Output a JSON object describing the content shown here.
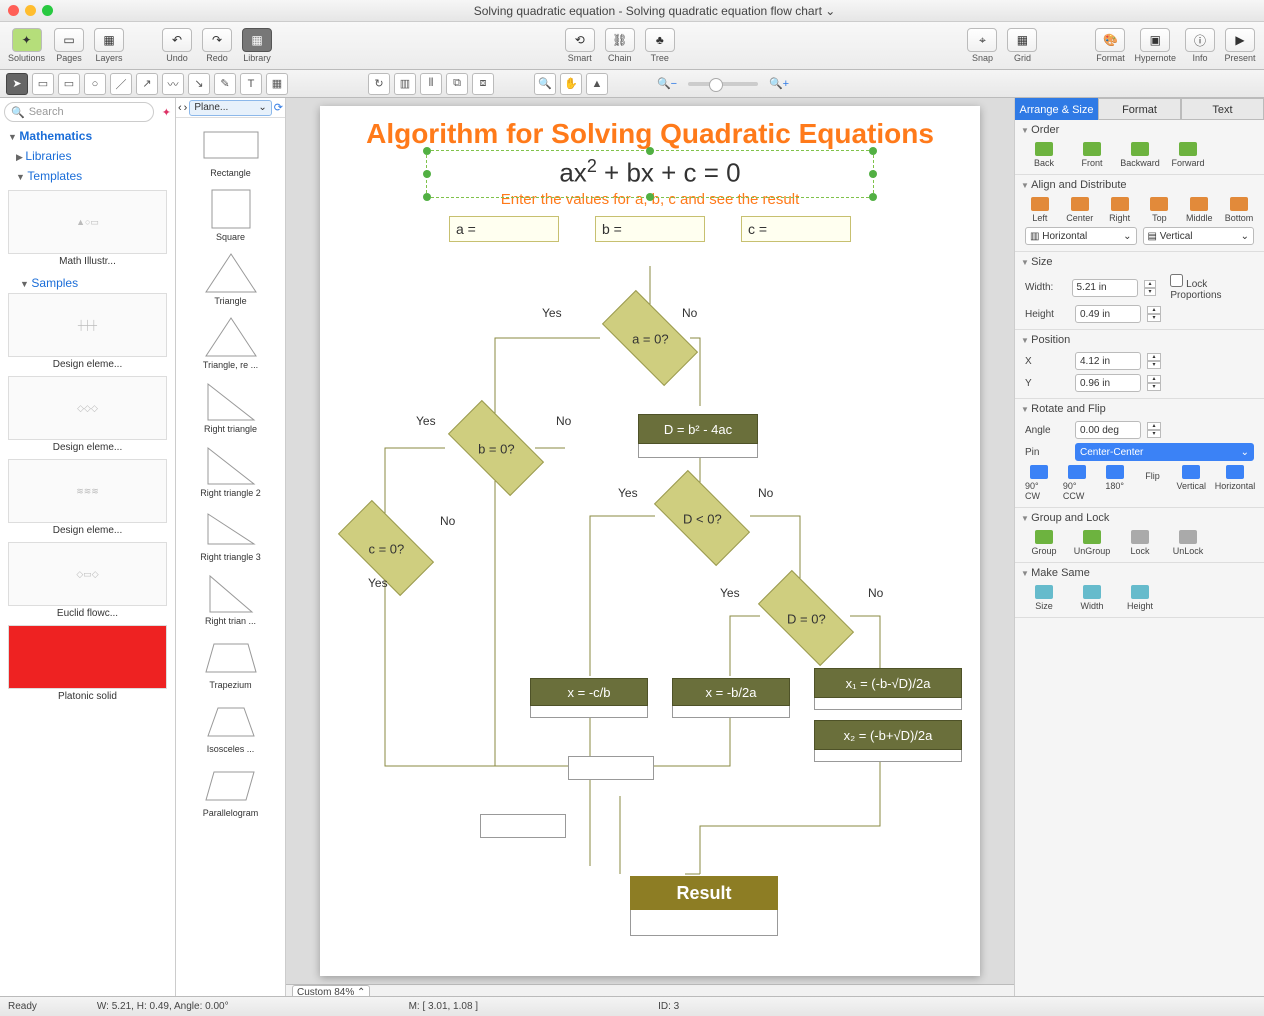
{
  "window": {
    "title": "Solving quadratic equation - Solving quadratic equation flow chart ⌄"
  },
  "toolbar": {
    "solutions": "Solutions",
    "pages": "Pages",
    "layers": "Layers",
    "undo": "Undo",
    "redo": "Redo",
    "library": "Library",
    "smart": "Smart",
    "chain": "Chain",
    "tree": "Tree",
    "snap": "Snap",
    "grid": "Grid",
    "format": "Format",
    "hypernote": "Hypernote",
    "info": "Info",
    "present": "Present"
  },
  "search": {
    "placeholder": "Search"
  },
  "tree": {
    "root": "Mathematics",
    "libraries": "Libraries",
    "templates": "Templates",
    "samples": "Samples",
    "thumbs": [
      {
        "label": "Math Illustr..."
      },
      {
        "label": "Design eleme..."
      },
      {
        "label": "Design eleme..."
      },
      {
        "label": "Design eleme..."
      },
      {
        "label": "Euclid flowc..."
      },
      {
        "label": "Platonic solid"
      }
    ]
  },
  "shapes": {
    "selector": "Plane...",
    "list": [
      {
        "label": "Rectangle"
      },
      {
        "label": "Square"
      },
      {
        "label": "Triangle"
      },
      {
        "label": "Triangle, re ..."
      },
      {
        "label": "Right triangle"
      },
      {
        "label": "Right triangle 2"
      },
      {
        "label": "Right triangle 3"
      },
      {
        "label": "Right trian ..."
      },
      {
        "label": "Trapezium"
      },
      {
        "label": "Isosceles ..."
      },
      {
        "label": "Parallelogram"
      }
    ]
  },
  "flowchart": {
    "title": "Algorithm for Solving Quadratic Equations",
    "equation_html": "ax<sup>2</sup> + bx + c = 0",
    "subtitle": "Enter the values for a, b, c and see the result",
    "inputs": {
      "a": "a =",
      "b": "b =",
      "c": "c ="
    },
    "nodes": {
      "a0": "a = 0?",
      "b0": "b = 0?",
      "c0": "c = 0?",
      "d_calc": "D = b² - 4ac",
      "d_lt": "D < 0?",
      "d_eq": "D = 0?",
      "x_cb": "x = -c/b",
      "x_b2a": "x = -b/2a",
      "x1": "x₁ = (-b-√D)/2a",
      "x2": "x₂ = (-b+√D)/2a",
      "result": "Result"
    },
    "labels": {
      "yes": "Yes",
      "no": "No"
    }
  },
  "zoom": {
    "label": "Custom 84%"
  },
  "inspector": {
    "tabs": {
      "arrange": "Arrange & Size",
      "format": "Format",
      "text": "Text"
    },
    "order": {
      "hdr": "Order",
      "back": "Back",
      "front": "Front",
      "backward": "Backward",
      "forward": "Forward"
    },
    "align": {
      "hdr": "Align and Distribute",
      "left": "Left",
      "center": "Center",
      "right": "Right",
      "top": "Top",
      "middle": "Middle",
      "bottom": "Bottom",
      "horizontal": "Horizontal",
      "vertical": "Vertical"
    },
    "size": {
      "hdr": "Size",
      "width_l": "Width:",
      "width_v": "5.21 in",
      "height_l": "Height",
      "height_v": "0.49 in",
      "lock": "Lock Proportions"
    },
    "position": {
      "hdr": "Position",
      "x_l": "X",
      "x_v": "4.12 in",
      "y_l": "Y",
      "y_v": "0.96 in"
    },
    "rotate": {
      "hdr": "Rotate and Flip",
      "angle_l": "Angle",
      "angle_v": "0.00 deg",
      "pin_l": "Pin",
      "pin_v": "Center-Center",
      "cw": "90° CW",
      "ccw": "90° CCW",
      "r180": "180°",
      "flip": "Flip",
      "vert": "Vertical",
      "horiz": "Horizontal"
    },
    "group": {
      "hdr": "Group and Lock",
      "group": "Group",
      "ungroup": "UnGroup",
      "lock": "Lock",
      "unlock": "UnLock"
    },
    "same": {
      "hdr": "Make Same",
      "size": "Size",
      "width": "Width",
      "height": "Height"
    }
  },
  "status": {
    "ready": "Ready",
    "wh": "W: 5.21,  H: 0.49,  Angle: 0.00°",
    "m": "M: [ 3.01, 1.08 ]",
    "id": "ID: 3"
  }
}
